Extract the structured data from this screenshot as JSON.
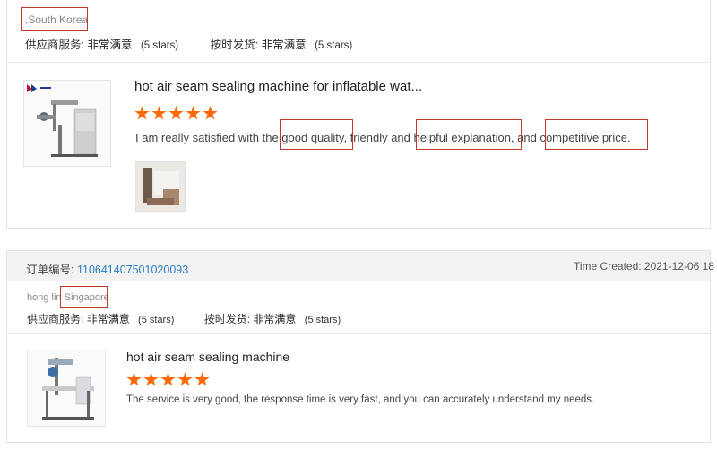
{
  "review1": {
    "country": ",South Korea",
    "supplier_service_label": "供应商服务:",
    "supplier_service_value": "非常满意",
    "supplier_service_stars": "(5 stars)",
    "ontime_label": "按时发货:",
    "ontime_value": "非常满意",
    "ontime_stars": "(5 stars)",
    "product_title": "hot air seam sealing machine for inflatable wat...",
    "rating": 5,
    "comment_parts": [
      "I am really satisfied with the ",
      "good quality",
      ", friendly and ",
      "helpful explanation",
      ", and ",
      "competitive price."
    ]
  },
  "review2": {
    "order_label": "订单编号:",
    "order_number": "110641407501020093",
    "time_created": "Time Created: 2021-12-06 18",
    "buyer": "hong lin",
    "country": "Singapore",
    "supplier_service_label": "供应商服务:",
    "supplier_service_value": "非常满意",
    "supplier_service_stars": "(5 stars)",
    "ontime_label": "按时发货:",
    "ontime_value": "非常满意",
    "ontime_stars": "(5 stars)",
    "product_title": "hot air seam sealing machine",
    "rating": 5,
    "comment": "The service is very good, the response time is very fast, and you can accurately understand my needs."
  },
  "colors": {
    "accent_star": "#ff6a00",
    "highlight_box": "#c0392b",
    "order_link": "#2a7fc6"
  }
}
